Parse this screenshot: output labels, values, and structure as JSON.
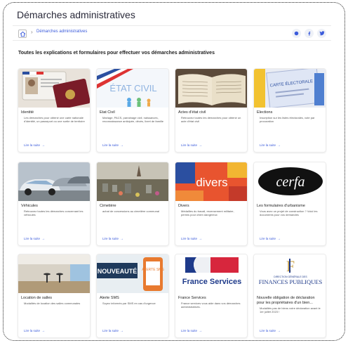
{
  "page": {
    "title": "Démarches administratives",
    "breadcrumb": "Démarches administratives",
    "intro": "Toutes les explications et formulaires pour effectuer vos démarches administratives",
    "accent_color": "#3b5bdb"
  },
  "social": [
    "print-icon",
    "facebook-icon",
    "twitter-icon"
  ],
  "cards": [
    {
      "title": "Identité",
      "desc": "Les démarches pour obtenir une carte nationale d'identité, un passeport ou une sortie de territoire",
      "more": "Lire la suite"
    },
    {
      "title": "Etat Civil",
      "desc": "Mariage, PACS, parrainage civil, naissances, reconnaissance anticipée, décès, livret de famille",
      "more": "Lire la suite",
      "banner": "ÉTAT CIVIL"
    },
    {
      "title": "Actes d'état civil",
      "desc": "Retrouvez toutes les démarches pour obtenir un acte d'état civil",
      "more": "Lire la suite"
    },
    {
      "title": "Elections",
      "desc": "Inscription sur les listes électorales, vote par procuration",
      "more": "Lire la suite",
      "banner": "CARTE ÉLECTORALE"
    },
    {
      "title": "Véhicules",
      "desc": "Retrouvez toutes les démarches concernant les véhicules",
      "more": "Lire la suite"
    },
    {
      "title": "Cimetière",
      "desc": "achat de concessions au cimetière communal",
      "more": "Lire la suite"
    },
    {
      "title": "Divers",
      "desc": "Médailles du travail, recensement militaire, permis pour chien dangereux",
      "more": "Lire la suite",
      "banner": "divers"
    },
    {
      "title": "Les formulaires d'urbanisme",
      "desc": "Vous avez un projet de construction ? Voici les documents pour vos demandes",
      "more": "Lire la suite",
      "banner": "cerfa"
    },
    {
      "title": "Location de salles",
      "desc": "Modalités de location des salles communales",
      "more": "Lire la suite"
    },
    {
      "title": "Alerte SMS",
      "desc": "Soyez informés par SMS en cas d'urgence",
      "more": "Lire la suite",
      "banner": "NOUVEAUTÉ",
      "banner2": "ALERTE SMS"
    },
    {
      "title": "France Services",
      "desc": "France services vous aide dans vos démarches administratives.",
      "more": "Lire la suite",
      "banner": "France Services"
    },
    {
      "title": "Nouvelle obligation de déclaration pour les propriétaires d'un bien...",
      "desc": "Modalités pas de biens votre déclaration avant le 1er juillet 2023 !",
      "more": "Lire la suite",
      "banner": "FINANCES PUBLIQUES",
      "banner2": "DIRECTION GÉNÉRALE DES"
    }
  ]
}
